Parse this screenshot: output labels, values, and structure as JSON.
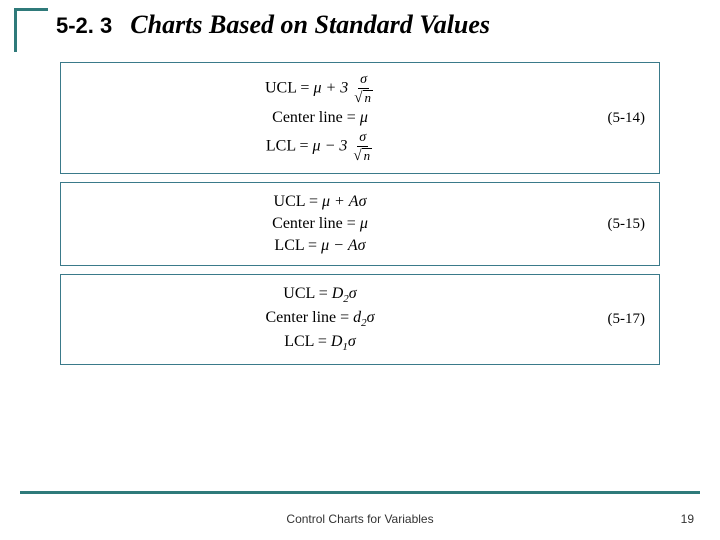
{
  "header": {
    "section_number": "5-2. 3",
    "title": "Charts Based on Standard Values"
  },
  "boxes": [
    {
      "ref": "(5-14)",
      "lines": {
        "ucl_label": "UCL",
        "ucl_rhs_pre": "μ + 3",
        "center_label": "Center line",
        "center_rhs": "μ",
        "lcl_label": "LCL",
        "lcl_rhs_pre": "μ − 3",
        "frac_top": "σ",
        "frac_bot_sqrt_arg": "n"
      }
    },
    {
      "ref": "(5-15)",
      "lines": {
        "ucl_label": "UCL",
        "ucl_rhs": "μ + Aσ",
        "center_label": "Center line",
        "center_rhs": "μ",
        "lcl_label": "LCL",
        "lcl_rhs": "μ − Aσ"
      }
    },
    {
      "ref": "(5-17)",
      "lines": {
        "ucl_label": "UCL",
        "ucl_rhs_html": "D<sub>2</sub>σ",
        "center_label": "Center line",
        "center_rhs_html": "d<sub>2</sub>σ",
        "lcl_label": "LCL",
        "lcl_rhs_html": "D<sub>1</sub>σ"
      }
    }
  ],
  "footer": {
    "text": "Control Charts for Variables",
    "page": "19"
  }
}
